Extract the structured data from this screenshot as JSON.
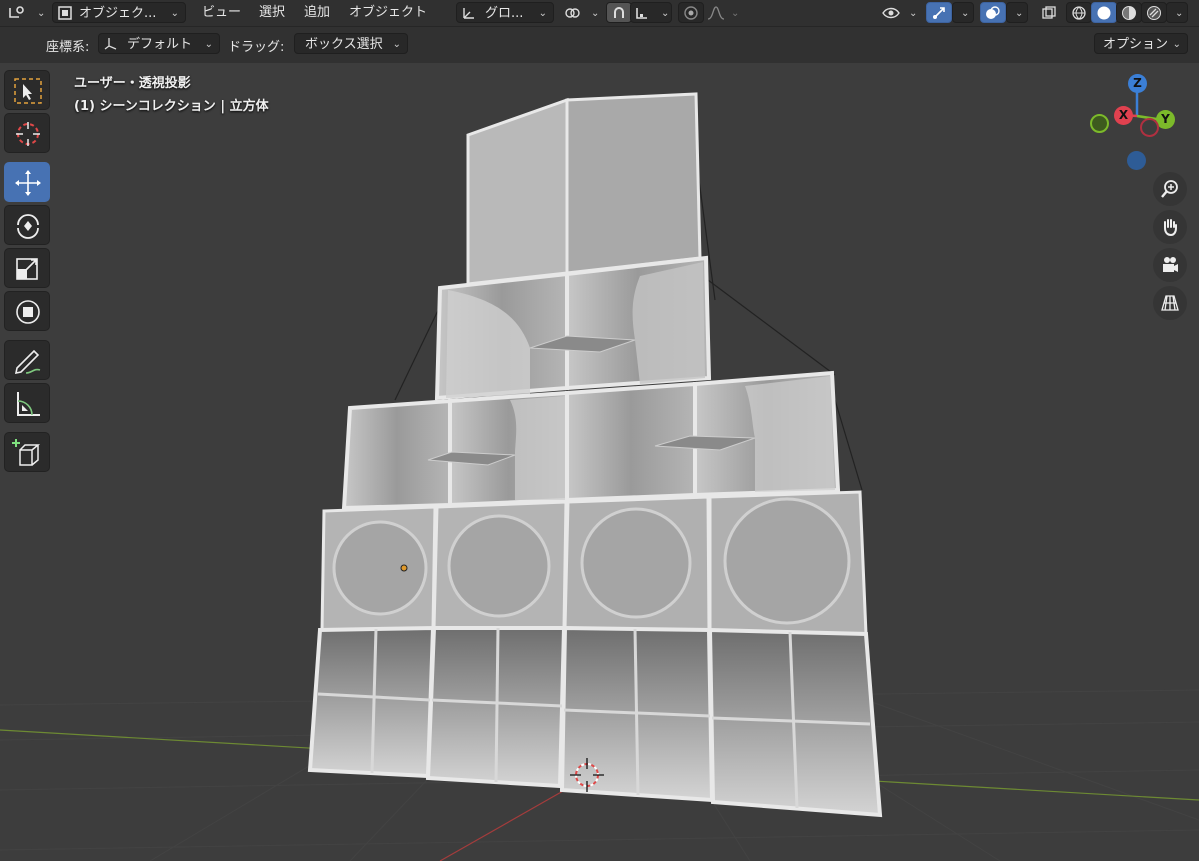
{
  "header": {
    "mode_label": "オブジェク...",
    "menus": [
      "ビュー",
      "選択",
      "追加",
      "オブジェクト"
    ],
    "transform_orientation": "グロ..."
  },
  "toolrow": {
    "coord_label": "座標系:",
    "coord_value": "デフォルト",
    "drag_label": "ドラッグ:",
    "drag_value": "ボックス選択",
    "options_label": "オプション"
  },
  "viewport": {
    "view_name": "ユーザー・透視投影",
    "collection_info": "(1) シーンコレクション | 立方体"
  },
  "gizmo": {
    "z_label": "Z",
    "x_label": "X",
    "y_label": "Y"
  },
  "colors": {
    "accent_blue": "#4772b3",
    "axis_x": "#e0414f",
    "axis_y": "#7cba2a",
    "axis_z": "#3b7fd6",
    "grid_line": "#434343",
    "background": "#3d3d3d"
  },
  "tools": [
    {
      "name": "select-box-tool-icon"
    },
    {
      "name": "cursor-tool-icon"
    },
    {
      "name": "move-tool-icon"
    },
    {
      "name": "rotate-tool-icon"
    },
    {
      "name": "scale-tool-icon"
    },
    {
      "name": "transform-tool-icon"
    },
    {
      "name": "annotate-tool-icon"
    },
    {
      "name": "measure-tool-icon"
    },
    {
      "name": "add-cube-tool-icon"
    }
  ]
}
